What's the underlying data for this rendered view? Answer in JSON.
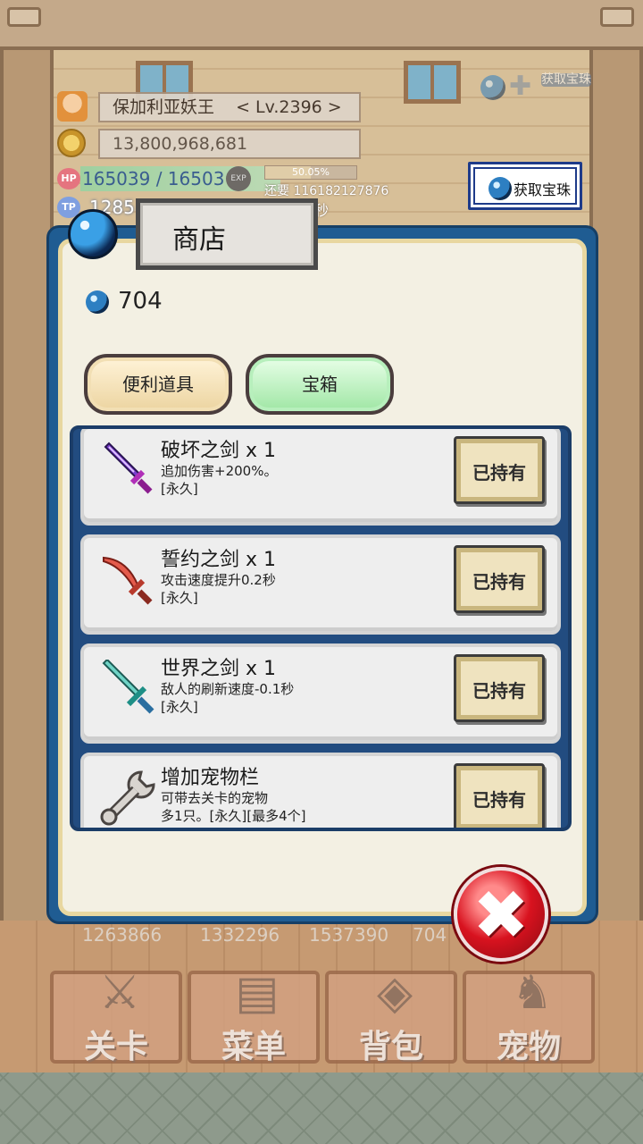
{
  "player": {
    "name": "保加利亚妖王",
    "level": "< Lv.2396 >",
    "gold": "13,800,968,681",
    "hp_label": "HP",
    "hp": "165039 / 16503",
    "exp_icon": "EXP",
    "exp_percent": "50.05%",
    "exp_fraction": 0.5005,
    "exp_remaining": "还要 116182127876",
    "tp_label": "TP",
    "tp": "1285",
    "tp_suffix": "秒"
  },
  "top_buttons": {
    "gem_shop_label": "获取宝珠",
    "get_gem_label": "获取宝珠"
  },
  "shop": {
    "title": "商店",
    "gem_count": "704",
    "tabs": [
      {
        "label": "便利道具",
        "active": false
      },
      {
        "label": "宝箱",
        "active": true
      }
    ],
    "items": [
      {
        "name": "破坏之剑 x 1",
        "desc": "追加伤害+200%。",
        "tag": "[永久]",
        "button": "已持有",
        "icon": "purple-sword-icon"
      },
      {
        "name": "誓约之剑 x 1",
        "desc": "攻击速度提升0.2秒",
        "tag": "[永久]",
        "button": "已持有",
        "icon": "red-saber-icon"
      },
      {
        "name": "世界之剑 x 1",
        "desc": "敌人的刷新速度-0.1秒",
        "tag": "[永久]",
        "button": "已持有",
        "icon": "teal-sword-icon"
      },
      {
        "name": "增加宠物栏",
        "desc": "可带去关卡的宠物",
        "tag": "多1只。[永久][最多4个]",
        "button": "已持有",
        "icon": "wrench-icon"
      }
    ]
  },
  "resources": {
    "r1": "1263866",
    "r2": "1332296",
    "r3": "1537390",
    "r4": "704"
  },
  "nav": {
    "stage": "关卡",
    "menu": "菜单",
    "bag": "背包",
    "pet": "宠物"
  },
  "colors": {
    "dialog_border": "#1f5c92",
    "dialog_bg": "#f3f0e3",
    "tab_active": "#9fe6a4",
    "tab_inactive": "#ecd4a0",
    "close_red": "#d8121f"
  }
}
